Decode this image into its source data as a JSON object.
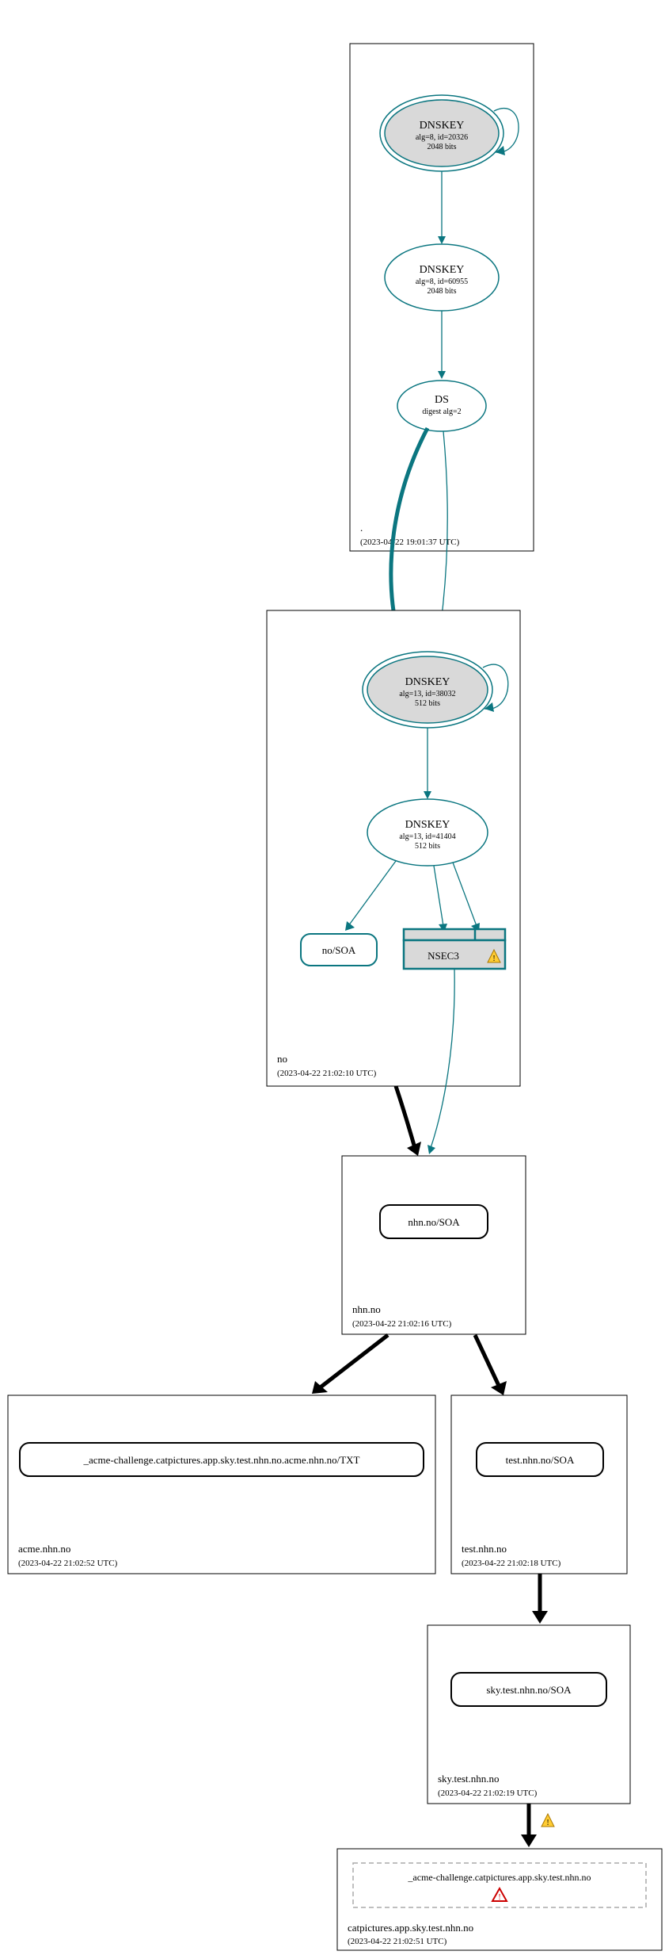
{
  "zones": {
    "root": {
      "name": ".",
      "timestamp": "(2023-04-22 19:01:37 UTC)"
    },
    "no": {
      "name": "no",
      "timestamp": "(2023-04-22 21:02:10 UTC)"
    },
    "nhn": {
      "name": "nhn.no",
      "timestamp": "(2023-04-22 21:02:16 UTC)"
    },
    "acme": {
      "name": "acme.nhn.no",
      "timestamp": "(2023-04-22 21:02:52 UTC)"
    },
    "test": {
      "name": "test.nhn.no",
      "timestamp": "(2023-04-22 21:02:18 UTC)"
    },
    "sky": {
      "name": "sky.test.nhn.no",
      "timestamp": "(2023-04-22 21:02:19 UTC)"
    },
    "cat": {
      "name": "catpictures.app.sky.test.nhn.no",
      "timestamp": "(2023-04-22 21:02:51 UTC)"
    }
  },
  "nodes": {
    "root_ksk": {
      "title": "DNSKEY",
      "sub1": "alg=8, id=20326",
      "sub2": "2048 bits"
    },
    "root_zsk": {
      "title": "DNSKEY",
      "sub1": "alg=8, id=60955",
      "sub2": "2048 bits"
    },
    "root_ds": {
      "title": "DS",
      "sub1": "digest alg=2"
    },
    "no_ksk": {
      "title": "DNSKEY",
      "sub1": "alg=13, id=38032",
      "sub2": "512 bits"
    },
    "no_zsk": {
      "title": "DNSKEY",
      "sub1": "alg=13, id=41404",
      "sub2": "512 bits"
    },
    "no_soa": {
      "label": "no/SOA"
    },
    "nsec3": {
      "label": "NSEC3"
    },
    "nhn_soa": {
      "label": "nhn.no/SOA"
    },
    "acme_txt": {
      "label": "_acme-challenge.catpictures.app.sky.test.nhn.no.acme.nhn.no/TXT"
    },
    "test_soa": {
      "label": "test.nhn.no/SOA"
    },
    "sky_soa": {
      "label": "sky.test.nhn.no/SOA"
    },
    "cat_node": {
      "label": "_acme-challenge.catpictures.app.sky.test.nhn.no"
    }
  }
}
